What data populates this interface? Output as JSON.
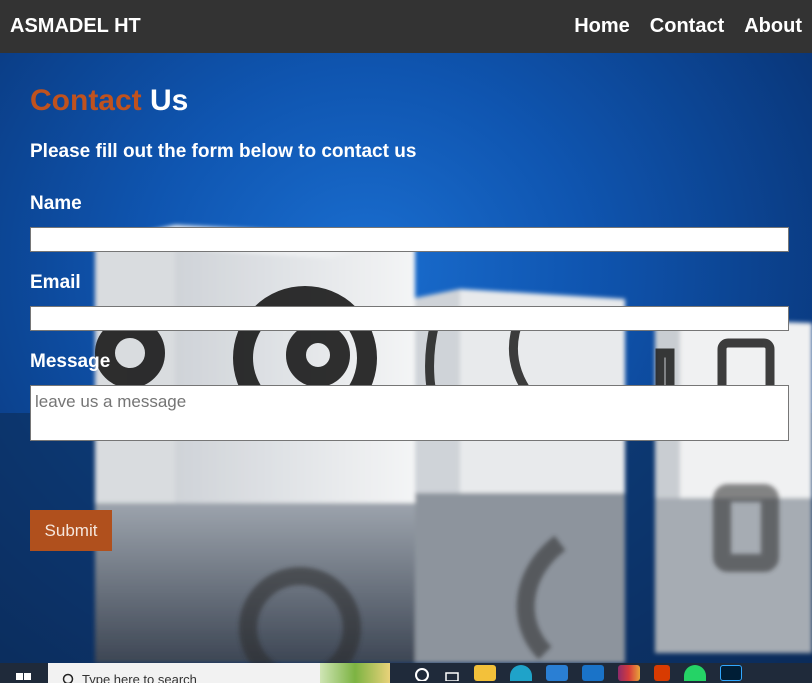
{
  "navbar": {
    "brand": "ASMADEL HT",
    "links": [
      "Home",
      "Contact",
      "About"
    ]
  },
  "contact": {
    "title_accent": "Contact",
    "title_rest": "Us",
    "subtitle": "Please fill out the form below to contact us",
    "name_label": "Name",
    "name_value": "",
    "email_label": "Email",
    "email_value": "",
    "message_label": "Message",
    "message_placeholder": "leave us a message",
    "submit_label": "Submit"
  },
  "taskbar": {
    "search_placeholder": "Type here to search",
    "icons": [
      "windows-start-icon",
      "search-icon",
      "task-view-icon",
      "file-explorer-icon",
      "edge-icon",
      "store-icon",
      "mail-icon",
      "winrar-icon",
      "office-icon",
      "whatsapp-icon",
      "photoshop-icon"
    ]
  },
  "colors": {
    "navbar_bg": "#333333",
    "accent": "#c0521e",
    "button_bg": "#b0501d",
    "hero_blue": "#1565c0"
  }
}
